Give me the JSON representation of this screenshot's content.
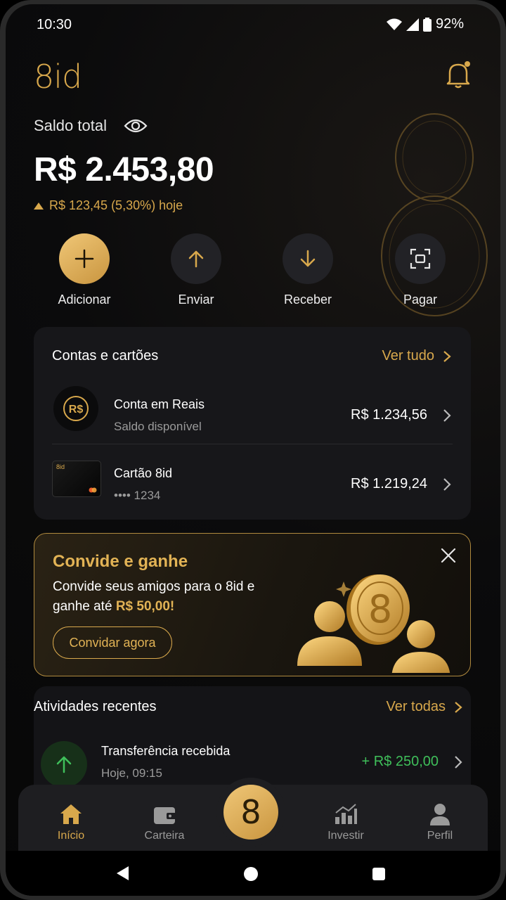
{
  "status_bar": {
    "time": "10:30",
    "battery": "92%"
  },
  "header": {
    "logo": "8id"
  },
  "balance": {
    "label": "Saldo total",
    "value": "R$ 2.453,80",
    "change": "R$ 123,45 (5,30%) hoje"
  },
  "actions": [
    {
      "label": "Adicionar",
      "icon": "plus-icon"
    },
    {
      "label": "Enviar",
      "icon": "arrow-up-icon"
    },
    {
      "label": "Receber",
      "icon": "arrow-down-icon"
    },
    {
      "label": "Pagar",
      "icon": "scan-icon"
    }
  ],
  "accounts": {
    "title": "Contas e cartões",
    "link": "Ver tudo",
    "items": [
      {
        "title": "Conta em Reais",
        "subtitle": "Saldo disponível",
        "amount": "R$ 1.234,56",
        "badge": "R$"
      },
      {
        "title": "Cartão 8id",
        "subtitle": "•••• 1234",
        "amount": "R$ 1.219,24",
        "card_label": "8id"
      }
    ]
  },
  "promo": {
    "title": "Convide e ganhe",
    "text_before": "Convide seus amigos para o 8id e ganhe até ",
    "text_bold": "R$ 50,00!",
    "button": "Convidar agora",
    "coin_symbol": "8"
  },
  "activities": {
    "title": "Atividades recentes",
    "link": "Ver todas",
    "items": [
      {
        "title": "Transferência recebida",
        "subtitle": "Hoje, 09:15",
        "amount": "+ R$ 250,00",
        "amount_color": "#3fbf5a"
      }
    ]
  },
  "bottom_nav": {
    "items": [
      {
        "label": "Início",
        "icon": "home-icon",
        "active": true
      },
      {
        "label": "Carteira",
        "icon": "wallet-icon",
        "active": false
      },
      {
        "label": "Investir",
        "icon": "chart-icon",
        "active": false
      },
      {
        "label": "Perfil",
        "icon": "person-icon",
        "active": false
      }
    ],
    "center_symbol": "8"
  },
  "colors": {
    "accent": "#d8a84c",
    "positive": "#3fbf5a",
    "background": "#0b0b0c"
  }
}
